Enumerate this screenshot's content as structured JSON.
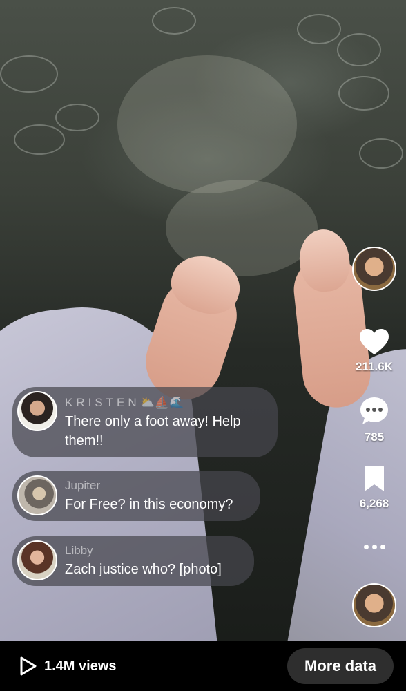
{
  "video": {
    "description_icon": "video-frame"
  },
  "rail": {
    "likes": "211.6K",
    "comments": "785",
    "saves": "6,268",
    "icons": [
      "heart-icon",
      "comment-icon",
      "bookmark-icon",
      "more-icon"
    ]
  },
  "comments": [
    {
      "name": "KRISTEN",
      "emoji": "⛅⛵🌊",
      "text_line1": "There only a foot away! Help",
      "text_line2": "them!!"
    },
    {
      "name": "Jupiter",
      "text": "For Free? in this economy?"
    },
    {
      "name": "Libby",
      "text": "Zach justice who? [photo]"
    }
  ],
  "bottom": {
    "views": "1.4M views",
    "more_data": "More data"
  },
  "colors": {
    "background": "#000000",
    "bubble": "#46464e",
    "button": "#2e2e2e",
    "text": "#ffffff"
  }
}
